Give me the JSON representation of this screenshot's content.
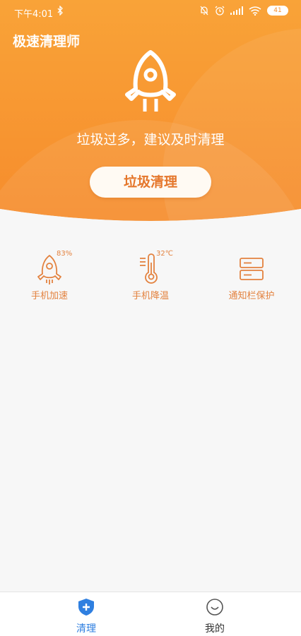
{
  "status_bar": {
    "time": "下午4:01",
    "battery": "41"
  },
  "app": {
    "title": "极速清理师"
  },
  "hero": {
    "message": "垃圾过多，建议及时清理",
    "clean_button": "垃圾清理"
  },
  "tools": [
    {
      "label": "手机加速",
      "badge": "83%",
      "icon": "rocket-icon"
    },
    {
      "label": "手机降温",
      "badge": "32℃",
      "icon": "thermometer-icon"
    },
    {
      "label": "通知栏保护",
      "badge": "",
      "icon": "notification-bar-icon"
    }
  ],
  "tabbar": {
    "items": [
      {
        "label": "清理",
        "icon": "shield-plus-icon",
        "active": true
      },
      {
        "label": "我的",
        "icon": "smiley-icon",
        "active": false
      }
    ]
  },
  "colors": {
    "accent": "#f7902f",
    "accent_light": "#f9a94a",
    "tool_text": "#e3823f",
    "tab_active": "#2f7fe0",
    "tab_inactive": "#333333",
    "background": "#f7f7f7"
  }
}
